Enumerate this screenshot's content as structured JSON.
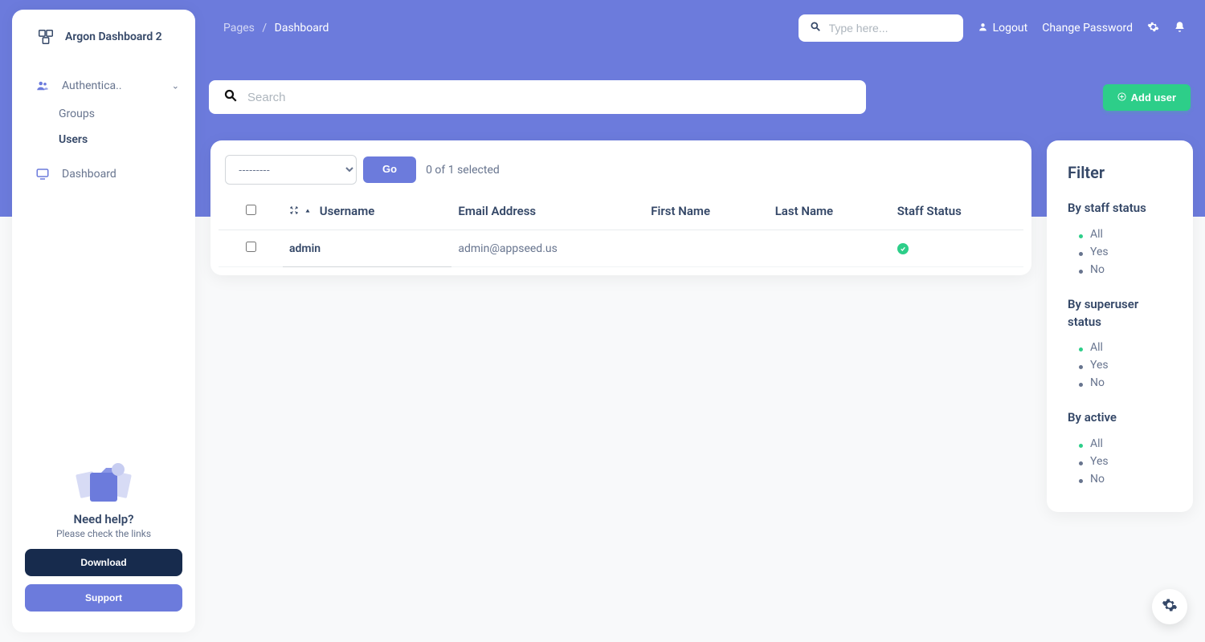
{
  "brand": {
    "name": "Argon Dashboard 2"
  },
  "sidebar": {
    "auth_label": "Authentica..",
    "sub": {
      "groups": "Groups",
      "users": "Users"
    },
    "dashboard": "Dashboard",
    "help": {
      "title": "Need help?",
      "subtitle": "Please check the links",
      "download": "Download",
      "support": "Support"
    }
  },
  "breadcrumb": {
    "root": "Pages",
    "current": "Dashboard"
  },
  "topbar": {
    "search_placeholder": "Type here...",
    "logout": "Logout",
    "change_password": "Change Password"
  },
  "main_search": {
    "placeholder": "Search"
  },
  "add_button": "Add user",
  "actions": {
    "select_placeholder": "---------",
    "go": "Go",
    "selection": "0 of 1 selected"
  },
  "table": {
    "headers": {
      "username": "Username",
      "email": "Email Address",
      "first_name": "First Name",
      "last_name": "Last Name",
      "staff_status": "Staff Status"
    },
    "rows": [
      {
        "username": "admin",
        "email": "admin@appseed.us",
        "first_name": "",
        "last_name": "",
        "staff_status": true
      }
    ]
  },
  "filter": {
    "title": "Filter",
    "groups": [
      {
        "label": "By staff status",
        "options": [
          "All",
          "Yes",
          "No"
        ],
        "selected": "All"
      },
      {
        "label": "By superuser status",
        "options": [
          "All",
          "Yes",
          "No"
        ],
        "selected": "All"
      },
      {
        "label": "By active",
        "options": [
          "All",
          "Yes",
          "No"
        ],
        "selected": "All"
      }
    ]
  }
}
